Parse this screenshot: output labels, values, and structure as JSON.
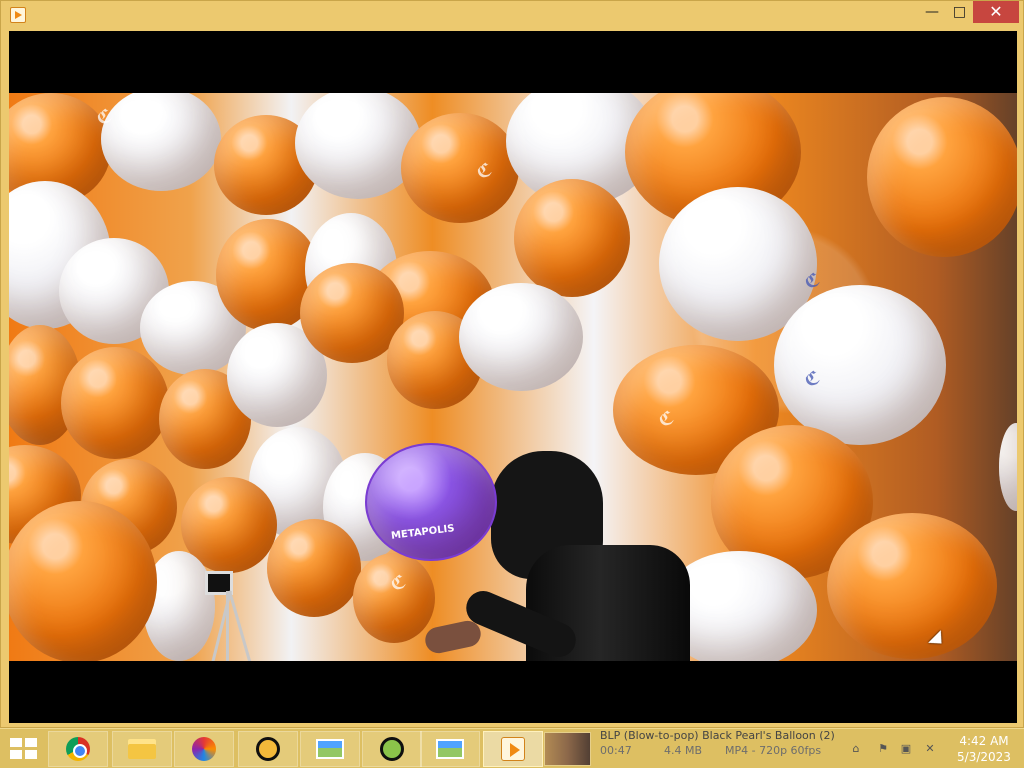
{
  "window": {
    "title": "",
    "controls": {
      "minimize": "—",
      "maximize": "□",
      "close": "✕"
    }
  },
  "video": {
    "balloon_prints": [
      "ℭ",
      "ℭ",
      "ℭ",
      "ℭ",
      "ℭ",
      "ℭ"
    ],
    "purple_balloon_text": "METAPOLIS"
  },
  "taskbar": {
    "media_title": "BLP (Blow-to-pop) Black Pearl's Balloon (2)",
    "duration": "00:47",
    "file_size": "4.4 MB",
    "format": "MP4 - 720p 60fps",
    "clock_time": "4:42 AM",
    "clock_date": "5/3/2023",
    "icons": {
      "start": "windows-start-icon",
      "chrome": "chrome-icon",
      "file_explorer": "file-explorer-icon",
      "color_app": "color-wheel-icon",
      "document_app": "document-icon",
      "chart_app": "chart-icon",
      "green_app": "green-app-icon",
      "photos": "photos-icon",
      "media_player": "media-player-icon",
      "network": "network-icon",
      "flag": "action-center-flag-icon",
      "monitor": "display-icon",
      "volume": "volume-muted-icon"
    }
  }
}
